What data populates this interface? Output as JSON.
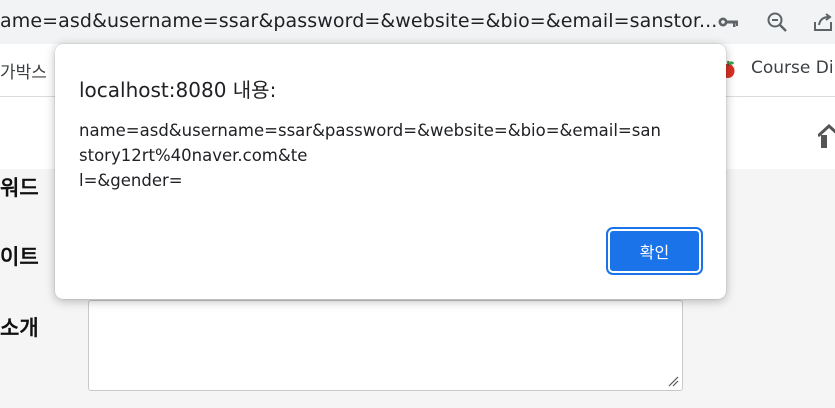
{
  "browser": {
    "url": "ame=asd&username=ssar&password=&website=&bio=&email=sanstor...",
    "bookmarks": {
      "left_partial": "가박스",
      "course": "Course Dir"
    },
    "icons": [
      "key-icon",
      "zoom-icon",
      "share-icon"
    ]
  },
  "page": {
    "labels": [
      "워드",
      "이트",
      "소개"
    ]
  },
  "dialog": {
    "title": "localhost:8080 내용:",
    "message_lines": [
      "name=asd&username=ssar&password=&website=&bio=&email=san",
      "story12rt%40naver.com&te",
      "l=&gender="
    ],
    "ok_label": "확인"
  },
  "colors": {
    "accent": "#1a73e8",
    "page_bg": "#f5f5f5",
    "toolbar_bg": "#f1f3f4"
  }
}
